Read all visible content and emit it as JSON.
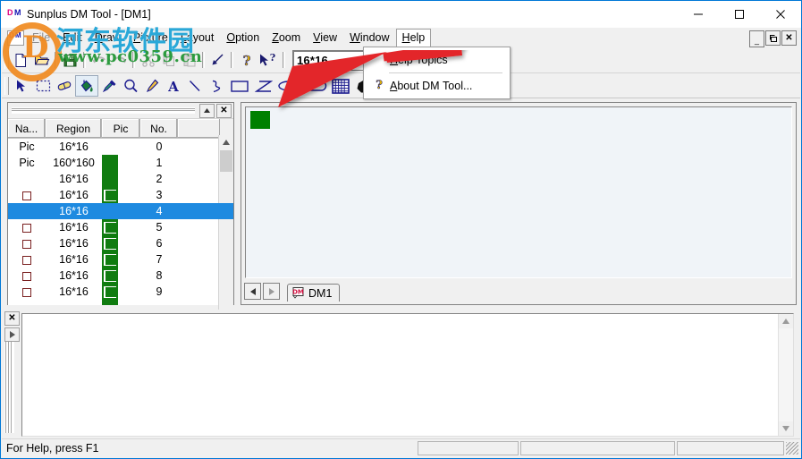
{
  "window": {
    "title": "Sunplus DM Tool - [DM1]",
    "icon": "dm-app-icon",
    "controls": {
      "minimize": "minimize-icon",
      "maximize": "maximize-icon",
      "close": "close-icon"
    }
  },
  "menubar": {
    "child_icon": "dm-document-icon",
    "items": [
      {
        "label": "File",
        "accel": "F",
        "state": "normal"
      },
      {
        "label": "Edit",
        "accel": "E",
        "state": "normal"
      },
      {
        "label": "Draw",
        "accel": "D",
        "state": "normal"
      },
      {
        "label": "Picture",
        "accel": "P",
        "state": "normal"
      },
      {
        "label": "Layout",
        "accel": "L",
        "state": "normal"
      },
      {
        "label": "Option",
        "accel": "O",
        "state": "normal"
      },
      {
        "label": "Zoom",
        "accel": "Z",
        "state": "normal"
      },
      {
        "label": "View",
        "accel": "V",
        "state": "normal"
      },
      {
        "label": "Window",
        "accel": "W",
        "state": "normal"
      },
      {
        "label": "Help",
        "accel": "H",
        "state": "open"
      }
    ],
    "mdi_buttons": [
      {
        "label": "_",
        "name": "mdi-minimize-button"
      },
      {
        "label": "❐",
        "name": "mdi-restore-button"
      },
      {
        "label": "✕",
        "name": "mdi-close-button"
      }
    ]
  },
  "help_menu": {
    "items": [
      {
        "label": "Help Topics",
        "accel": "H",
        "icon": "none"
      },
      {
        "label": "About DM Tool...",
        "accel": "A",
        "icon": "question-mark-icon"
      }
    ]
  },
  "toolbar_main": {
    "buttons": [
      {
        "name": "new-file-button",
        "icon": "new-document-icon",
        "enabled": true
      },
      {
        "name": "open-file-button",
        "icon": "open-folder-icon",
        "enabled": true
      },
      {
        "name": "save-file-button",
        "icon": "floppy-disk-icon",
        "enabled": true
      },
      {
        "name": "undo-button",
        "icon": "undo-arrow-icon",
        "enabled": false
      },
      {
        "name": "redo-button",
        "icon": "redo-arrow-icon",
        "enabled": false
      },
      {
        "name": "cut-button",
        "icon": "scissors-icon",
        "enabled": false
      },
      {
        "name": "copy-button",
        "icon": "copy-pages-icon",
        "enabled": false
      },
      {
        "name": "paste-button",
        "icon": "clipboard-paste-icon",
        "enabled": false
      },
      {
        "name": "apply-button",
        "icon": "check-arrow-icon",
        "enabled": true
      },
      {
        "name": "help-button",
        "icon": "question-mark-icon",
        "enabled": true
      },
      {
        "name": "context-help-button",
        "icon": "arrow-question-icon",
        "enabled": true
      }
    ],
    "size_combo": {
      "name": "pixel-size-combo",
      "value": "16*16"
    },
    "second_combo": {
      "name": "secondary-combo",
      "value": ""
    }
  },
  "toolbar_draw": {
    "tools": [
      {
        "name": "select-tool",
        "icon": "arrow-pointer-icon",
        "active": false
      },
      {
        "name": "marquee-select-tool",
        "icon": "dashed-rectangle-icon",
        "active": false
      },
      {
        "name": "eraser-tool",
        "icon": "eraser-icon",
        "active": false
      },
      {
        "name": "fill-tool",
        "icon": "paint-bucket-icon",
        "active": true
      },
      {
        "name": "color-picker-tool",
        "icon": "eyedropper-icon",
        "active": false
      },
      {
        "name": "zoom-tool",
        "icon": "magnifier-icon",
        "active": false
      },
      {
        "name": "pencil-tool",
        "icon": "pencil-icon",
        "active": false
      },
      {
        "name": "text-tool",
        "icon": "text-A-icon",
        "active": false
      },
      {
        "name": "line-tool",
        "icon": "line-icon",
        "active": false
      },
      {
        "name": "curve-tool",
        "icon": "curve-icon",
        "active": false
      },
      {
        "name": "rectangle-tool",
        "icon": "rectangle-icon",
        "active": false
      },
      {
        "name": "polygon-tool",
        "icon": "polygon-icon",
        "active": false
      },
      {
        "name": "ellipse-tool",
        "icon": "ellipse-icon",
        "active": false
      },
      {
        "name": "rounded-rect-tool",
        "icon": "rounded-rectangle-icon",
        "active": false
      },
      {
        "name": "grid-tool",
        "icon": "grid-icon",
        "active": false
      },
      {
        "name": "filled-shape-tool",
        "icon": "filled-circle-icon",
        "active": false
      }
    ]
  },
  "list_panel": {
    "title_buttons": [
      {
        "name": "panel-collapse-button",
        "label": "▴"
      },
      {
        "name": "panel-close-button",
        "label": "✕"
      }
    ],
    "columns": [
      "Na...",
      "Region",
      "Pic",
      "No.",
      ""
    ],
    "rows": [
      {
        "name": "Pic",
        "region": "16*16",
        "pic": "",
        "no": "0",
        "checked": false,
        "selected": false,
        "green": false
      },
      {
        "name": "Pic",
        "region": "160*160",
        "pic": "",
        "no": "1",
        "checked": false,
        "selected": false,
        "green": true
      },
      {
        "name": "",
        "region": "16*16",
        "pic": "",
        "no": "2",
        "checked": false,
        "selected": false,
        "green": true
      },
      {
        "name": "",
        "region": "16*16",
        "pic": "",
        "no": "3",
        "checked": true,
        "selected": false,
        "green": true
      },
      {
        "name": "",
        "region": "16*16",
        "pic": "",
        "no": "4",
        "checked": false,
        "selected": true,
        "green": true
      },
      {
        "name": "",
        "region": "16*16",
        "pic": "",
        "no": "5",
        "checked": true,
        "selected": false,
        "green": true
      },
      {
        "name": "",
        "region": "16*16",
        "pic": "",
        "no": "6",
        "checked": true,
        "selected": false,
        "green": true
      },
      {
        "name": "",
        "region": "16*16",
        "pic": "",
        "no": "7",
        "checked": true,
        "selected": false,
        "green": true
      },
      {
        "name": "",
        "region": "16*16",
        "pic": "",
        "no": "8",
        "checked": true,
        "selected": false,
        "green": true
      },
      {
        "name": "",
        "region": "16*16",
        "pic": "",
        "no": "9",
        "checked": true,
        "selected": false,
        "green": true
      }
    ],
    "selection_color": "#1e8ae0",
    "green_color": "#107c10"
  },
  "document": {
    "canvas_swatch_color": "#008000",
    "tab_label": "DM1",
    "tab_icon": "dm-document-icon",
    "nav_prev": "◄",
    "nav_next": "►"
  },
  "output_panel": {
    "close_label": "✕",
    "expand_label": "▸",
    "content": ""
  },
  "statusbar": {
    "message": "For Help, press F1",
    "panes": [
      "",
      "",
      ""
    ]
  },
  "watermark": {
    "chinese": "河东软件园",
    "url": "www.pc0359.cn",
    "logo_letter": "D",
    "logo_color": "#f08a20",
    "text_color": "#2aa8d8",
    "url_color": "#2d9b3f"
  },
  "annotation": {
    "arrow_color": "#e3262a",
    "arrow_target": "Help Topics"
  }
}
